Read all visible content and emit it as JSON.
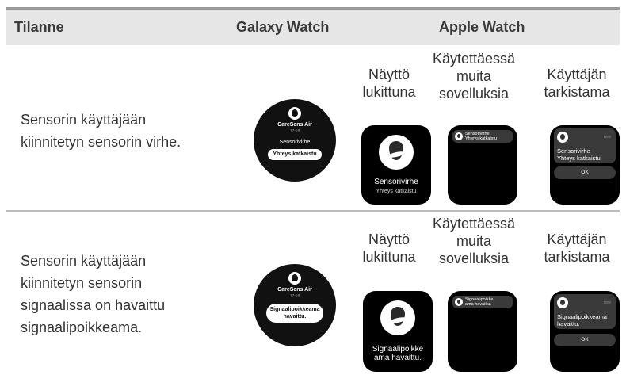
{
  "headers": [
    "Tilanne",
    "Galaxy Watch",
    "Apple Watch"
  ],
  "apple_columns": {
    "locked": [
      "Näyttö",
      "lukittuna"
    ],
    "other_apps": [
      "Käytettäessä",
      "muita",
      "sovelluksia"
    ],
    "user_viewing": [
      "Käyttäjän",
      "tarkistama"
    ]
  },
  "rows": [
    {
      "situation_lines": [
        "Sensorin käyttäjään",
        "kiinnitetyn sensorin virhe."
      ],
      "galaxy": {
        "app": "CareSens Air",
        "time": "17:18",
        "message": "Sensorivirhe",
        "pill": "Yhteys katkaistu"
      },
      "apple_locked": {
        "title": "Sensorivirhe",
        "subtitle": "Yhteys katkaistu"
      },
      "apple_other": [
        "Sensorivirhe",
        "Yhteys katkaistu"
      ],
      "apple_viewing": {
        "now": "now",
        "lines": [
          "Sensorivirhe",
          "Yhteys katkaistu"
        ],
        "ok": "OK"
      }
    },
    {
      "situation_lines": [
        "Sensorin käyttäjään",
        "kiinnitetyn sensorin",
        "signaalissa on havaittu",
        "signaalipoikkeama."
      ],
      "galaxy": {
        "app": "CareSens Air",
        "time": "17:18",
        "pill_lines": [
          "Signaalipoikkeama",
          "havaittu."
        ]
      },
      "apple_locked": {
        "title_lines": [
          "Signaalipoikke",
          "ama havaittu."
        ]
      },
      "apple_other": [
        "Signaalipoikke",
        "ama havaittu."
      ],
      "apple_viewing": {
        "now": "now",
        "lines": [
          "Signaalipoikkeama",
          "havaittu."
        ],
        "ok": "OK"
      }
    }
  ]
}
